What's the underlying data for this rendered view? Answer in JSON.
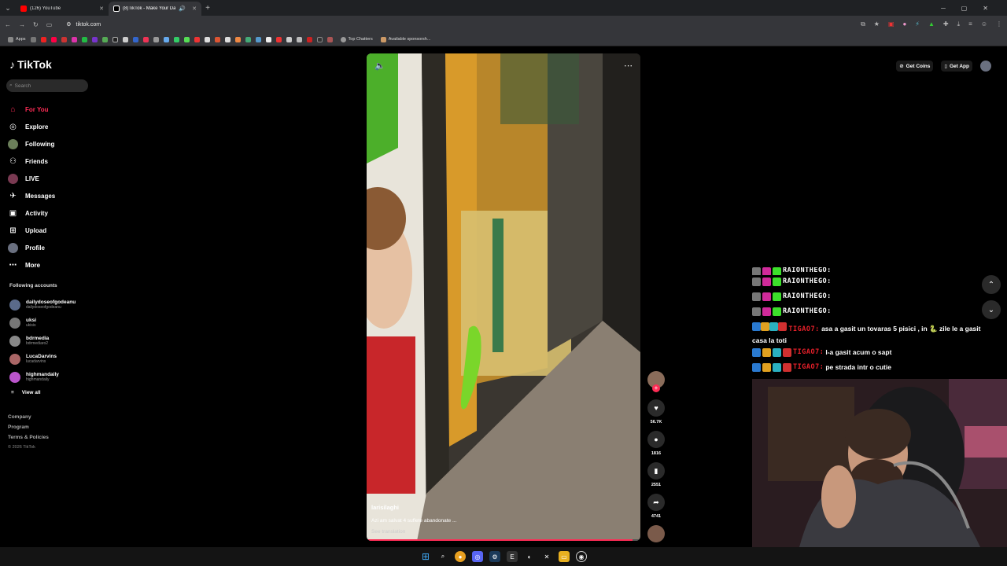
{
  "browser": {
    "tabs": [
      {
        "title": "(126) YouTube",
        "color": "#ff0000"
      },
      {
        "title": "(8)TikTok - Make Your Day",
        "color": "#ffffff"
      }
    ],
    "url": "tiktok.com",
    "bookmarks": {
      "apps_label": "Apps",
      "top_chatters": "Top Chatters",
      "sponsors": "Available sponsorsh..."
    }
  },
  "tiktok": {
    "brand": "TikTok",
    "search_placeholder": "Search",
    "nav": [
      {
        "label": "For You",
        "icon": "home-icon"
      },
      {
        "label": "Explore",
        "icon": "compass-icon"
      },
      {
        "label": "Following",
        "icon": "following-avatar-icon"
      },
      {
        "label": "Friends",
        "icon": "friends-icon"
      },
      {
        "label": "LIVE",
        "icon": "live-icon"
      },
      {
        "label": "Messages",
        "icon": "messages-icon"
      },
      {
        "label": "Activity",
        "icon": "activity-icon"
      },
      {
        "label": "Upload",
        "icon": "upload-icon"
      },
      {
        "label": "Profile",
        "icon": "profile-icon"
      },
      {
        "label": "More",
        "icon": "more-icon"
      }
    ],
    "following_header": "Following accounts",
    "accounts": [
      {
        "name": "dailydoseofgodeanu",
        "handle": "dailydoseofgodeanu"
      },
      {
        "name": "uksi",
        "handle": "ukisis"
      },
      {
        "name": "bdrmedia",
        "handle": "bdrmediaro2"
      },
      {
        "name": "LucaDarvins",
        "handle": "lucadarvins"
      },
      {
        "name": "highmandaily",
        "handle": "highmandaily"
      }
    ],
    "view_all": "View all",
    "footer": {
      "company": "Company",
      "program": "Program",
      "terms": "Terms & Policies",
      "copyright": "© 2026 TikTok"
    },
    "top_right": {
      "get_coins": "Get Coins",
      "get_app": "Get App"
    },
    "video": {
      "username": "larisilaghi",
      "description": "Azi am salvat 4 suflete abandonate ...",
      "see_translation": "See translation",
      "progress": 0.97
    },
    "actions": {
      "likes": "56.7K",
      "comments": "1816",
      "saves": "2551",
      "shares": "4741"
    }
  },
  "chat": {
    "messages": [
      {
        "user": "RAIONTHEGO:",
        "text": ""
      },
      {
        "user": "RAIONTHEGO:",
        "text": ""
      },
      {
        "user": "RAIONTHEGO:",
        "text": ""
      },
      {
        "user": "RAIONTHEGO:",
        "text": ""
      },
      {
        "user": "TIGAO7:",
        "text": "asa a gasit un tovaras 5 pisici , in 🐍 zile le a gasit casa la toti"
      },
      {
        "user": "TIGAO7:",
        "text": "l-a gasit acum o sapt"
      },
      {
        "user": "TIGAO7:",
        "text": "pe strada intr o cutie"
      }
    ],
    "colors": {
      "raion": "#ffffff",
      "tiga": "#e8202a"
    }
  }
}
